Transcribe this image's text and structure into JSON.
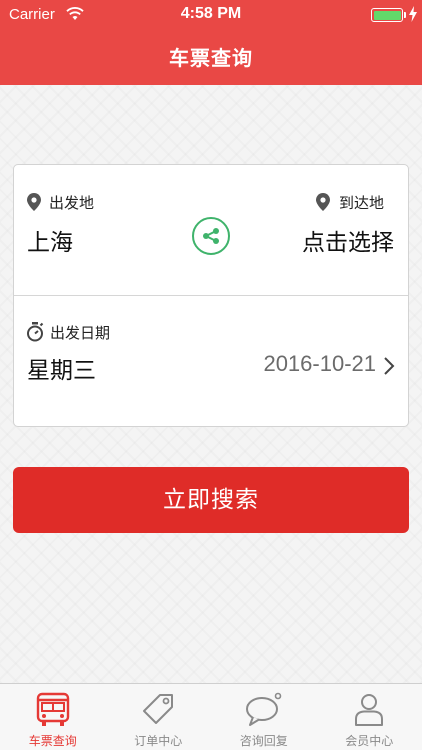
{
  "status_bar": {
    "carrier": "Carrier",
    "time": "4:58 PM",
    "wifi_icon": "wifi-icon",
    "battery_icon": "battery-icon"
  },
  "header": {
    "title": "车票查询",
    "color": "#e94845"
  },
  "form": {
    "departure": {
      "label": "出发地",
      "value": "上海",
      "icon": "location-pin-icon"
    },
    "arrival": {
      "label": "到达地",
      "value": "点击选择",
      "icon": "location-pin-icon"
    },
    "swap_icon": "swap-share-icon",
    "date": {
      "label": "出发日期",
      "weekday": "星期三",
      "date": "2016-10-21",
      "icon": "stopwatch-icon"
    }
  },
  "search_button": {
    "label": "立即搜索",
    "color": "#df2c28"
  },
  "tabbar": {
    "items": [
      {
        "label": "车票查询",
        "icon": "bus-icon",
        "active": true
      },
      {
        "label": "订单中心",
        "icon": "tag-icon",
        "active": false
      },
      {
        "label": "咨询回复",
        "icon": "chat-bubble-icon",
        "active": false
      },
      {
        "label": "会员中心",
        "icon": "person-icon",
        "active": false
      }
    ],
    "active_color": "#e53935",
    "inactive_color": "#8a8a8a"
  }
}
